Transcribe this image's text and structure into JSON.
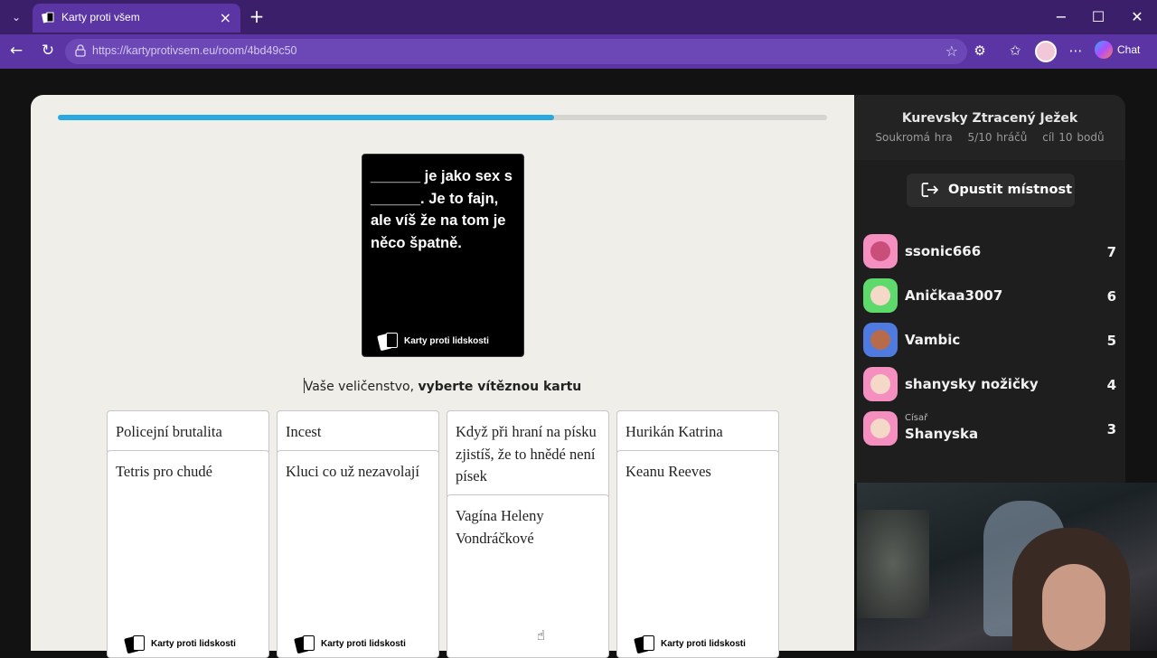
{
  "browser": {
    "tab_title": "Karty proti všem",
    "url": "https://kartyprotivsem.eu/room/4bd49c50",
    "chat_label": "Chat",
    "accent": "#5a35a3"
  },
  "game": {
    "progress_fraction": 0.645,
    "black_card_text": "______ je jako sex s ______. Je to fajn, ale víš že na tom je něco špatně.",
    "brand": "Karty proti lidskosti",
    "prompt_prefix": "Vaše veličenstvo, ",
    "prompt_bold": "vyberte vítěznou kartu",
    "columns": [
      {
        "cards": [
          "Policejní brutalita",
          "Tetris pro chudé"
        ]
      },
      {
        "cards": [
          "Incest",
          "Kluci co už nezavolají"
        ]
      },
      {
        "cards": [
          "Když při hraní na písku zjistíš, že to hnědé není písek",
          "Vagína Heleny Vondráčkové"
        ]
      },
      {
        "cards": [
          "Hurikán Katrina",
          "Keanu Reeves"
        ]
      }
    ]
  },
  "sidebar": {
    "room_name": "Kurevsky Ztracený Ježek",
    "meta": [
      "Soukromá hra",
      "5/10 hráčů",
      "cíl 10 bodů"
    ],
    "leave_label": "Opustit místnost",
    "players": [
      {
        "name": "ssonic666",
        "score": "7",
        "color": "#f48fc0",
        "face": "#c94f7a"
      },
      {
        "name": "Aničkaa3007",
        "score": "6",
        "color": "#5ed96c",
        "face": "#f5d9c8"
      },
      {
        "name": "Vambic",
        "score": "5",
        "color": "#4f7be0",
        "face": "#b86b4b"
      },
      {
        "name": "shanysky nožičky",
        "score": "4",
        "color": "#f48fc0",
        "face": "#f5d9c8"
      },
      {
        "name": "Shanyska",
        "role": "Císař",
        "score": "3",
        "color": "#f48fc0",
        "face": "#f5d9c8"
      }
    ]
  }
}
